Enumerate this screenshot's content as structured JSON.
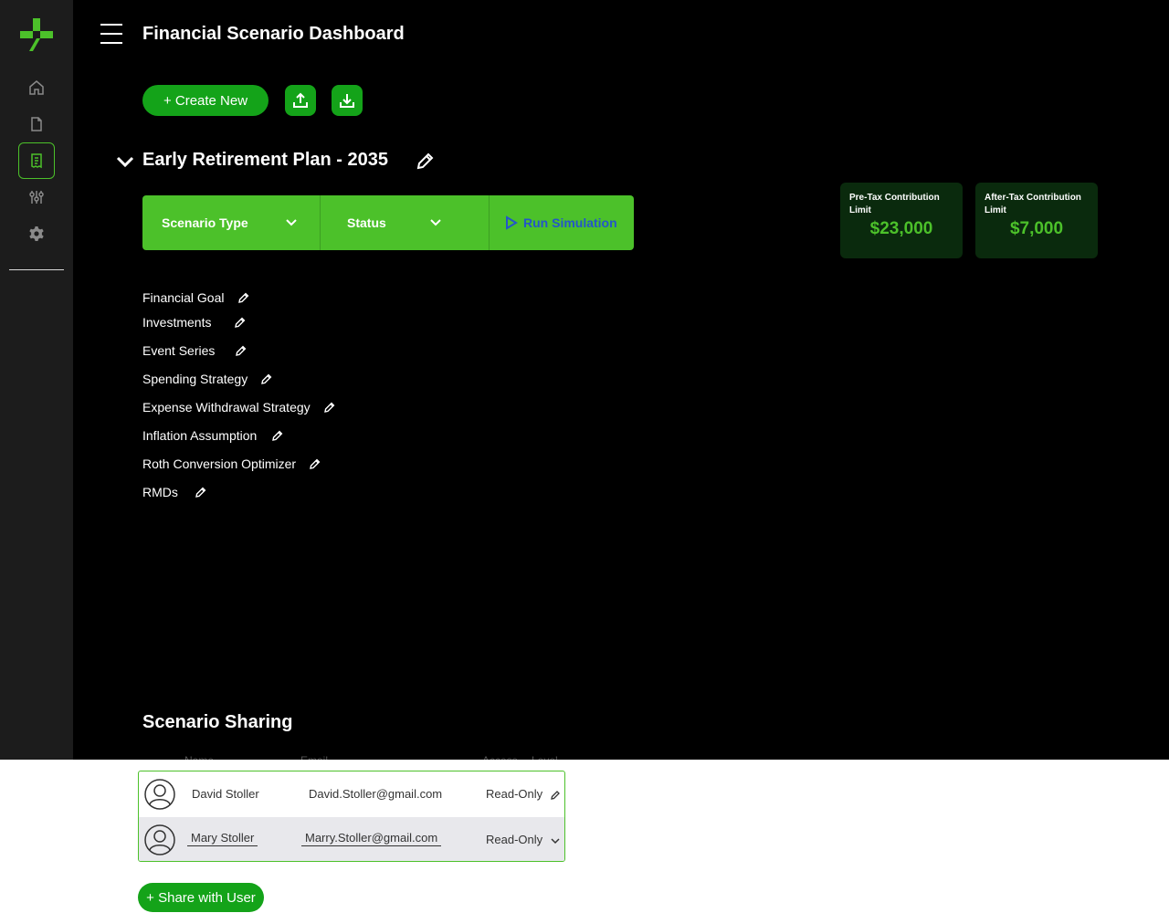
{
  "colors": {
    "accent": "#4cc12a",
    "button_green": "#14a319",
    "run_blue": "#2456c9",
    "card_bg": "#0a2a0d"
  },
  "sidebar": {
    "logo_icon": "plus-logo-icon",
    "items": [
      {
        "icon": "home-icon",
        "active": false
      },
      {
        "icon": "document-icon",
        "active": false
      },
      {
        "icon": "receipt-icon",
        "active": true
      },
      {
        "icon": "sliders-icon",
        "active": false
      },
      {
        "icon": "gear-icon",
        "active": false
      }
    ]
  },
  "header": {
    "title": "Financial Scenario Dashboard",
    "menu_icon": "hamburger-icon"
  },
  "toolbar": {
    "create_label": "+ Create New",
    "upload_icon": "upload-icon",
    "download_icon": "download-icon"
  },
  "scenario": {
    "title": "Early Retirement Plan - 2035",
    "type_label": "Scenario Type",
    "status_label": "Status",
    "run_label": "Run Simulation"
  },
  "limits": [
    {
      "label": "Pre-Tax Contribution Limit",
      "value": "$23,000"
    },
    {
      "label": "After-Tax Contribution Limit",
      "value": "$7,000"
    }
  ],
  "sections": [
    "Financial Goal",
    "Investments",
    "Event Series",
    "Spending Strategy",
    "Expense Withdrawal Strategy",
    "Inflation Assumption",
    "Roth Conversion Optimizer",
    "RMDs"
  ],
  "sharing": {
    "title": "Scenario Sharing",
    "headers": {
      "name": "Name",
      "email": "Email",
      "access": "Access",
      "level": "Level"
    },
    "rows": [
      {
        "name": "David Stoller",
        "email": "David.Stoller@gmail.com",
        "access": "Read-Only",
        "action_icon": "pencil-icon"
      },
      {
        "name": "Mary Stoller",
        "email": "Marry.Stoller@gmail.com",
        "access": "Read-Only",
        "action_icon": "chevron-down-icon"
      }
    ],
    "share_label": "+ Share with User"
  }
}
